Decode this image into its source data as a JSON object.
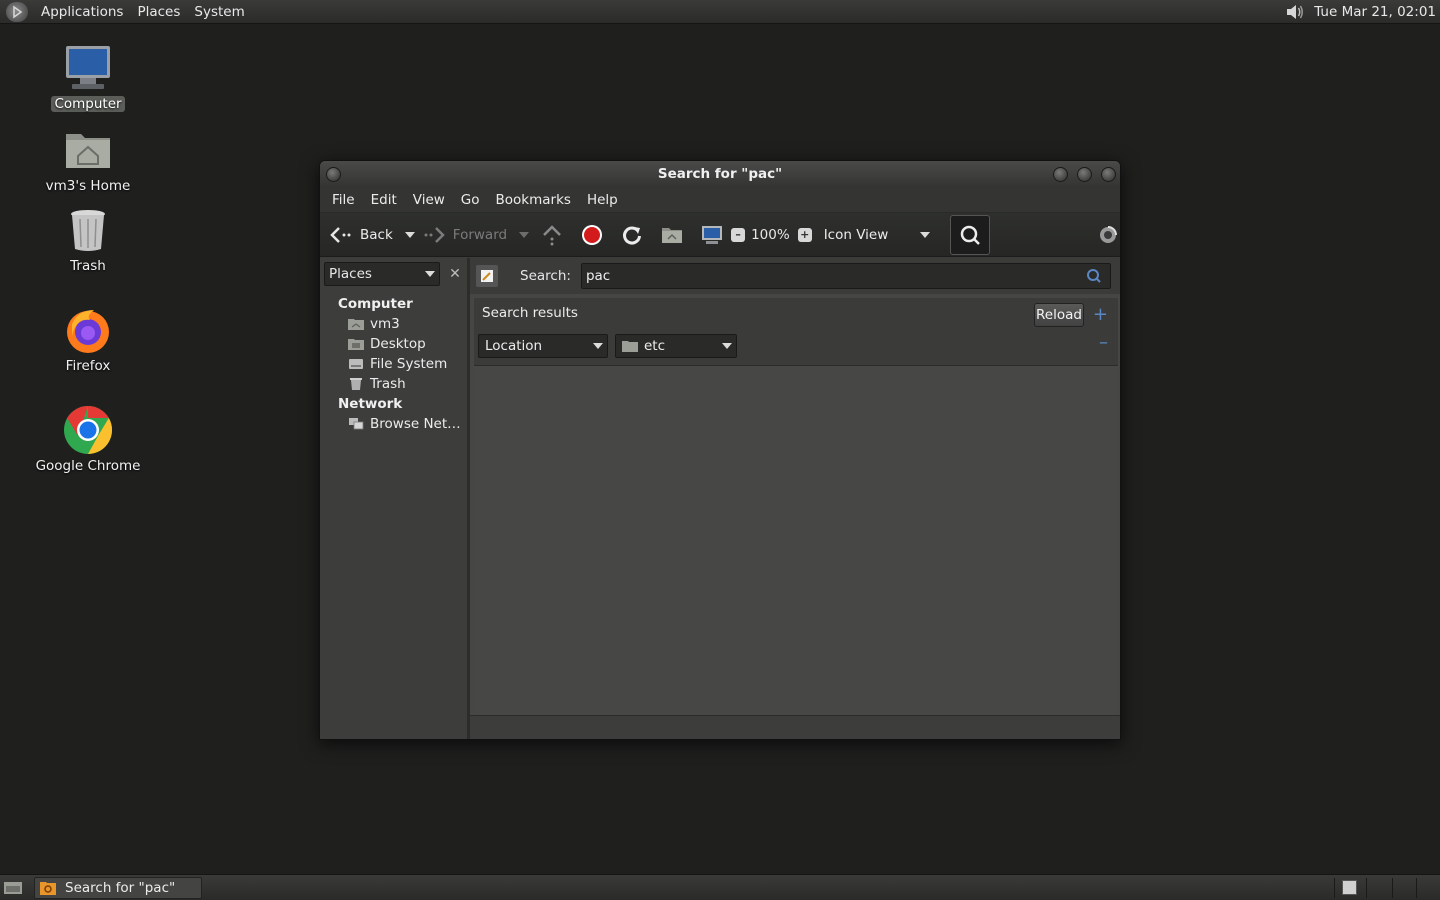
{
  "top_panel": {
    "menus": [
      "Applications",
      "Places",
      "System"
    ],
    "clock": "Tue Mar 21, 02:01"
  },
  "desktop": {
    "icons": [
      {
        "label": "Computer",
        "icon": "computer-icon",
        "selected": true
      },
      {
        "label": "vm3's Home",
        "icon": "home-folder-icon",
        "selected": false
      },
      {
        "label": "Trash",
        "icon": "trash-icon",
        "selected": false
      },
      {
        "label": "Firefox",
        "icon": "firefox-icon",
        "selected": false
      },
      {
        "label": "Google Chrome",
        "icon": "chrome-icon",
        "selected": false
      }
    ]
  },
  "window": {
    "title": "Search for \"pac\"",
    "menubar": [
      "File",
      "Edit",
      "View",
      "Go",
      "Bookmarks",
      "Help"
    ],
    "toolbar": {
      "back_label": "Back",
      "forward_label": "Forward",
      "zoom": "100%",
      "view_mode": "Icon View"
    },
    "sidebar": {
      "selector": "Places",
      "sections": [
        {
          "title": "Computer",
          "items": [
            "vm3",
            "Desktop",
            "File System",
            "Trash"
          ]
        },
        {
          "title": "Network",
          "items": [
            "Browse Net…"
          ]
        }
      ]
    },
    "search": {
      "label": "Search:",
      "value": "pac"
    },
    "results": {
      "title": "Search results",
      "reload_label": "Reload",
      "criterion_type": "Location",
      "criterion_value": "etc"
    }
  },
  "bottom_panel": {
    "task_label": "Search for \"pac\""
  },
  "colors": {
    "desktop_bg": "#1f201e",
    "panel_bg": "#333432",
    "accent_blue": "#5a86c4",
    "stop_red": "#d31b1b"
  }
}
